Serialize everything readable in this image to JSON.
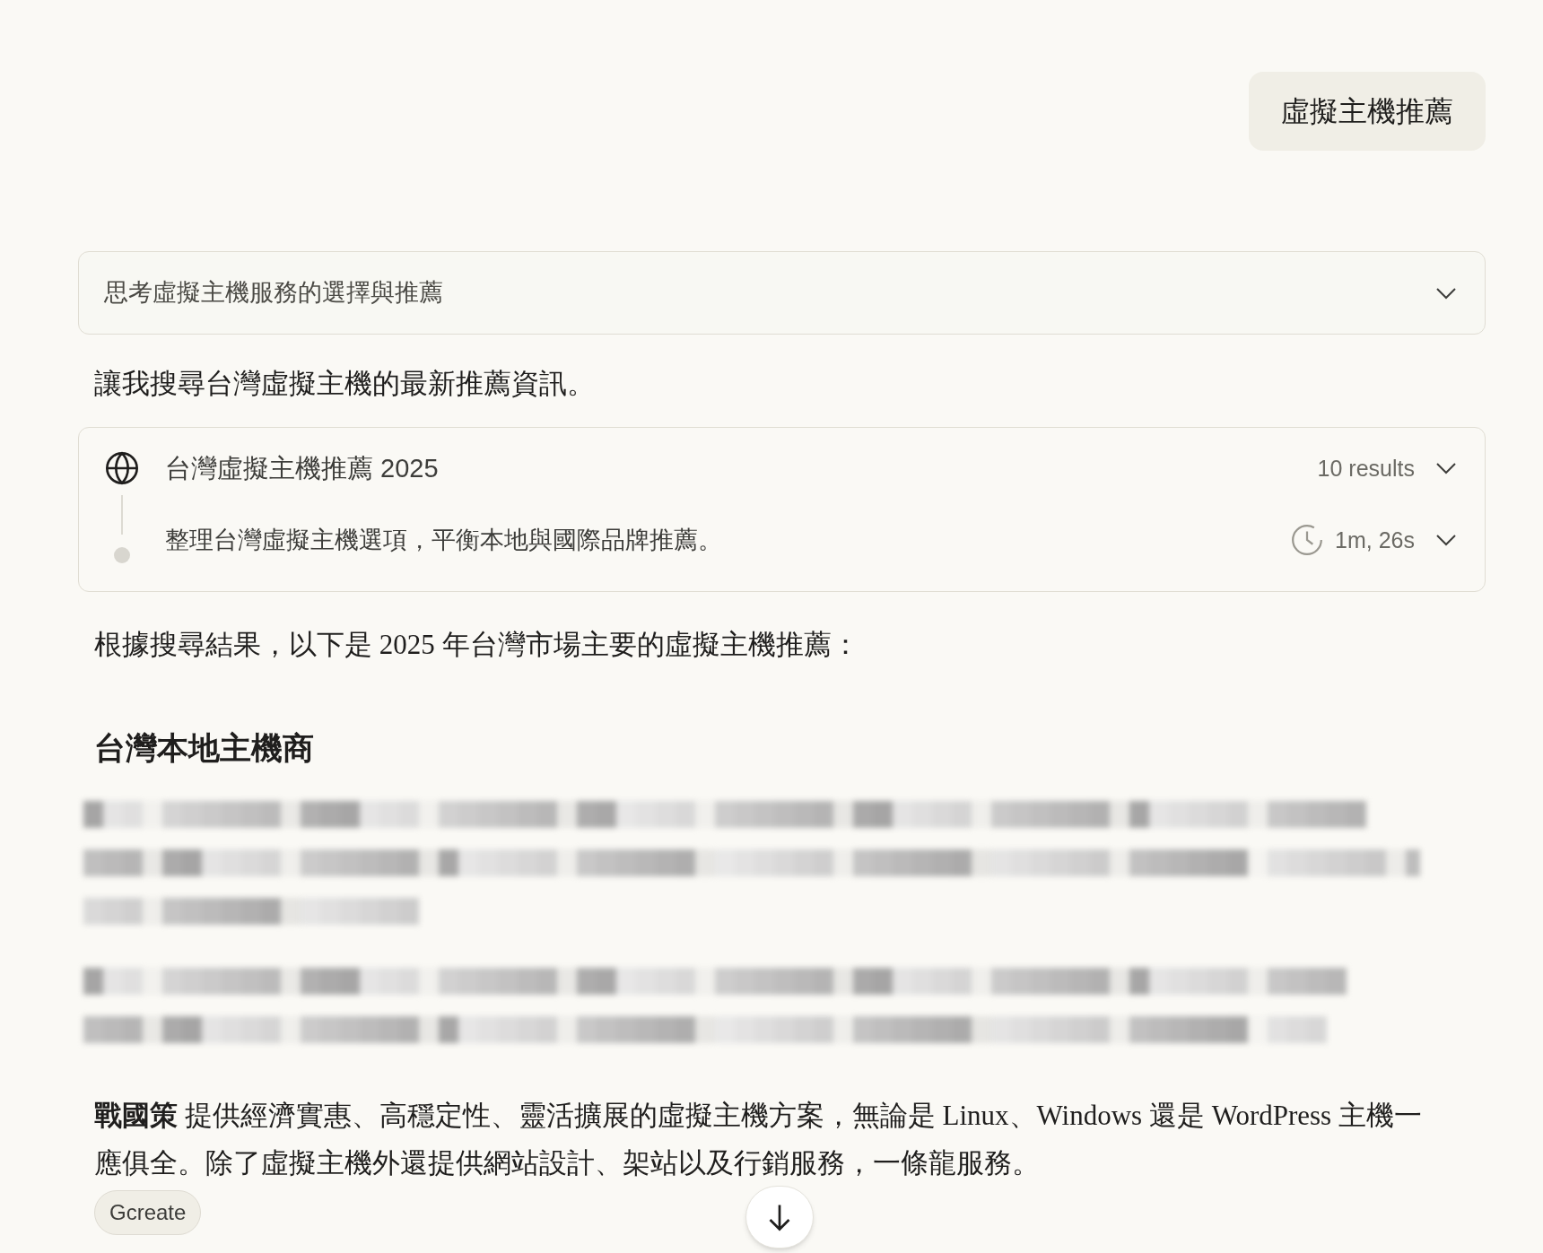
{
  "user_message": {
    "text": "虛擬主機推薦"
  },
  "thinking": {
    "label": "思考虛擬主機服務的選擇與推薦",
    "expanded": false
  },
  "intro": "讓我搜尋台灣虛擬主機的最新推薦資訊。",
  "search_panel": {
    "query": "台灣虛擬主機推薦 2025",
    "result_count": "10 results",
    "summary": "整理台灣虛擬主機選項，平衡本地與國際品牌推薦。",
    "duration": "1m, 26s"
  },
  "answer": {
    "lead": "根據搜尋結果，以下是 2025 年台灣市場主要的虛擬主機推薦：",
    "heading": "台灣本地主機商",
    "paragraph": "**戰國策** 提供經濟實惠、高穩定性、靈活擴展的虛擬主機方案，無論是 Linux、Windows 還是 WordPress 主機一應俱全。除了虛擬主機外還提供網站設計、架站以及行銷服務，一條龍服務。",
    "source_tag": "Gcreate"
  }
}
